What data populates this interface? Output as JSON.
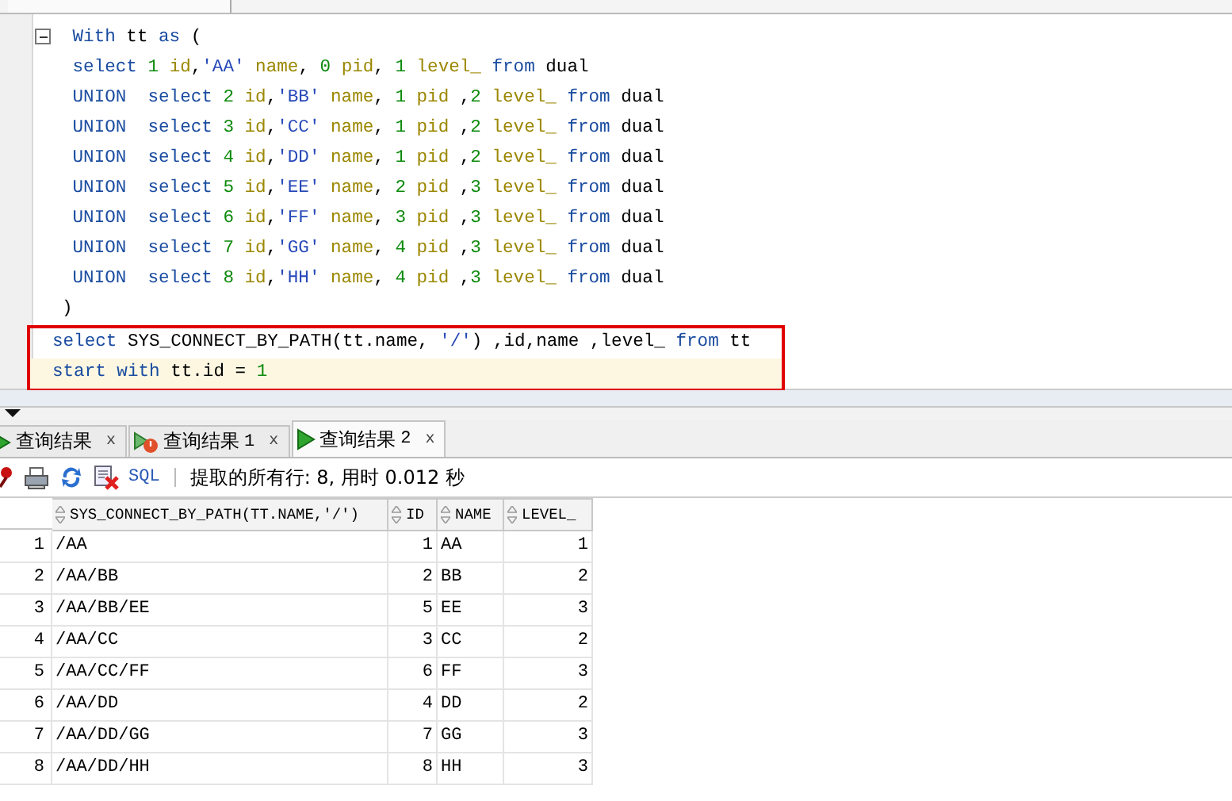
{
  "editor": {
    "lines": [
      {
        "boxed": false,
        "current": false,
        "tokens": [
          {
            "t": " With",
            "kind": "kw"
          },
          {
            "t": " tt ",
            "kind": "plain"
          },
          {
            "t": "as",
            "kind": "kw"
          },
          {
            "t": " (",
            "kind": "plain"
          }
        ]
      },
      {
        "boxed": false,
        "current": false,
        "tokens": [
          {
            "t": " select",
            "kind": "kw"
          },
          {
            "t": " 1 ",
            "kind": "num"
          },
          {
            "t": "id",
            "kind": "col"
          },
          {
            "t": ",",
            "kind": "plain"
          },
          {
            "t": "'AA'",
            "kind": "str"
          },
          {
            "t": " name",
            "kind": "col"
          },
          {
            "t": ", ",
            "kind": "plain"
          },
          {
            "t": "0 ",
            "kind": "num"
          },
          {
            "t": "pid",
            "kind": "col"
          },
          {
            "t": ", ",
            "kind": "plain"
          },
          {
            "t": "1 ",
            "kind": "num"
          },
          {
            "t": "level_ ",
            "kind": "col"
          },
          {
            "t": "from",
            "kind": "kw"
          },
          {
            "t": " dual",
            "kind": "plain"
          }
        ]
      },
      {
        "boxed": false,
        "current": false,
        "tokens": [
          {
            "t": " UNION  select",
            "kind": "kw"
          },
          {
            "t": " 2 ",
            "kind": "num"
          },
          {
            "t": "id",
            "kind": "col"
          },
          {
            "t": ",",
            "kind": "plain"
          },
          {
            "t": "'BB'",
            "kind": "str"
          },
          {
            "t": " name",
            "kind": "col"
          },
          {
            "t": ", ",
            "kind": "plain"
          },
          {
            "t": "1 ",
            "kind": "num"
          },
          {
            "t": "pid ",
            "kind": "col"
          },
          {
            "t": ",",
            "kind": "plain"
          },
          {
            "t": "2 ",
            "kind": "num"
          },
          {
            "t": "level_ ",
            "kind": "col"
          },
          {
            "t": "from",
            "kind": "kw"
          },
          {
            "t": " dual",
            "kind": "plain"
          }
        ]
      },
      {
        "boxed": false,
        "current": false,
        "tokens": [
          {
            "t": " UNION  select",
            "kind": "kw"
          },
          {
            "t": " 3 ",
            "kind": "num"
          },
          {
            "t": "id",
            "kind": "col"
          },
          {
            "t": ",",
            "kind": "plain"
          },
          {
            "t": "'CC'",
            "kind": "str"
          },
          {
            "t": " name",
            "kind": "col"
          },
          {
            "t": ", ",
            "kind": "plain"
          },
          {
            "t": "1 ",
            "kind": "num"
          },
          {
            "t": "pid ",
            "kind": "col"
          },
          {
            "t": ",",
            "kind": "plain"
          },
          {
            "t": "2 ",
            "kind": "num"
          },
          {
            "t": "level_ ",
            "kind": "col"
          },
          {
            "t": "from",
            "kind": "kw"
          },
          {
            "t": " dual",
            "kind": "plain"
          }
        ]
      },
      {
        "boxed": false,
        "current": false,
        "tokens": [
          {
            "t": " UNION  select",
            "kind": "kw"
          },
          {
            "t": " 4 ",
            "kind": "num"
          },
          {
            "t": "id",
            "kind": "col"
          },
          {
            "t": ",",
            "kind": "plain"
          },
          {
            "t": "'DD'",
            "kind": "str"
          },
          {
            "t": " name",
            "kind": "col"
          },
          {
            "t": ", ",
            "kind": "plain"
          },
          {
            "t": "1 ",
            "kind": "num"
          },
          {
            "t": "pid ",
            "kind": "col"
          },
          {
            "t": ",",
            "kind": "plain"
          },
          {
            "t": "2 ",
            "kind": "num"
          },
          {
            "t": "level_ ",
            "kind": "col"
          },
          {
            "t": "from",
            "kind": "kw"
          },
          {
            "t": " dual",
            "kind": "plain"
          }
        ]
      },
      {
        "boxed": false,
        "current": false,
        "tokens": [
          {
            "t": " UNION  select",
            "kind": "kw"
          },
          {
            "t": " 5 ",
            "kind": "num"
          },
          {
            "t": "id",
            "kind": "col"
          },
          {
            "t": ",",
            "kind": "plain"
          },
          {
            "t": "'EE'",
            "kind": "str"
          },
          {
            "t": " name",
            "kind": "col"
          },
          {
            "t": ", ",
            "kind": "plain"
          },
          {
            "t": "2 ",
            "kind": "num"
          },
          {
            "t": "pid ",
            "kind": "col"
          },
          {
            "t": ",",
            "kind": "plain"
          },
          {
            "t": "3 ",
            "kind": "num"
          },
          {
            "t": "level_ ",
            "kind": "col"
          },
          {
            "t": "from",
            "kind": "kw"
          },
          {
            "t": " dual",
            "kind": "plain"
          }
        ]
      },
      {
        "boxed": false,
        "current": false,
        "tokens": [
          {
            "t": " UNION  select",
            "kind": "kw"
          },
          {
            "t": " 6 ",
            "kind": "num"
          },
          {
            "t": "id",
            "kind": "col"
          },
          {
            "t": ",",
            "kind": "plain"
          },
          {
            "t": "'FF'",
            "kind": "str"
          },
          {
            "t": " name",
            "kind": "col"
          },
          {
            "t": ", ",
            "kind": "plain"
          },
          {
            "t": "3 ",
            "kind": "num"
          },
          {
            "t": "pid ",
            "kind": "col"
          },
          {
            "t": ",",
            "kind": "plain"
          },
          {
            "t": "3 ",
            "kind": "num"
          },
          {
            "t": "level_ ",
            "kind": "col"
          },
          {
            "t": "from",
            "kind": "kw"
          },
          {
            "t": " dual",
            "kind": "plain"
          }
        ]
      },
      {
        "boxed": false,
        "current": false,
        "tokens": [
          {
            "t": " UNION  select",
            "kind": "kw"
          },
          {
            "t": " 7 ",
            "kind": "num"
          },
          {
            "t": "id",
            "kind": "col"
          },
          {
            "t": ",",
            "kind": "plain"
          },
          {
            "t": "'GG'",
            "kind": "str"
          },
          {
            "t": " name",
            "kind": "col"
          },
          {
            "t": ", ",
            "kind": "plain"
          },
          {
            "t": "4 ",
            "kind": "num"
          },
          {
            "t": "pid ",
            "kind": "col"
          },
          {
            "t": ",",
            "kind": "plain"
          },
          {
            "t": "3 ",
            "kind": "num"
          },
          {
            "t": "level_ ",
            "kind": "col"
          },
          {
            "t": "from",
            "kind": "kw"
          },
          {
            "t": " dual",
            "kind": "plain"
          }
        ]
      },
      {
        "boxed": false,
        "current": false,
        "tokens": [
          {
            "t": " UNION  select",
            "kind": "kw"
          },
          {
            "t": " 8 ",
            "kind": "num"
          },
          {
            "t": "id",
            "kind": "col"
          },
          {
            "t": ",",
            "kind": "plain"
          },
          {
            "t": "'HH'",
            "kind": "str"
          },
          {
            "t": " name",
            "kind": "col"
          },
          {
            "t": ", ",
            "kind": "plain"
          },
          {
            "t": "4 ",
            "kind": "num"
          },
          {
            "t": "pid ",
            "kind": "col"
          },
          {
            "t": ",",
            "kind": "plain"
          },
          {
            "t": "3 ",
            "kind": "num"
          },
          {
            "t": "level_ ",
            "kind": "col"
          },
          {
            "t": "from",
            "kind": "kw"
          },
          {
            "t": " dual",
            "kind": "plain"
          }
        ]
      },
      {
        "boxed": false,
        "current": false,
        "tokens": [
          {
            "t": ")",
            "kind": "plain"
          }
        ]
      }
    ],
    "highlighted_lines": [
      {
        "boxed": true,
        "current": false,
        "tokens": [
          {
            "t": "select",
            "kind": "kw"
          },
          {
            "t": " SYS_CONNECT_BY_PATH(tt.name, ",
            "kind": "plain"
          },
          {
            "t": "'/'",
            "kind": "str"
          },
          {
            "t": ") ,id,name ,level_ ",
            "kind": "plain"
          },
          {
            "t": "from",
            "kind": "kw"
          },
          {
            "t": " tt",
            "kind": "plain"
          }
        ]
      },
      {
        "boxed": true,
        "current": true,
        "tokens": [
          {
            "t": "start with",
            "kind": "kw"
          },
          {
            "t": " tt.id = ",
            "kind": "plain"
          },
          {
            "t": "1",
            "kind": "num"
          }
        ]
      }
    ]
  },
  "result_tabs": [
    {
      "label": "查询结果",
      "kind": "ok",
      "close": "x",
      "selected": false
    },
    {
      "label": "查询结果",
      "number": "1",
      "kind": "error",
      "close": "x",
      "selected": false
    },
    {
      "label": "查询结果",
      "number": "2",
      "kind": "ok",
      "close": "x",
      "selected": true
    }
  ],
  "toolbar": {
    "sql_link": "SQL",
    "status": "提取的所有行: 8, 用时 0.012 秒"
  },
  "table": {
    "columns": [
      "SYS_CONNECT_BY_PATH(TT.NAME,'/')",
      "ID",
      "NAME",
      "LEVEL_"
    ],
    "rows": [
      {
        "num": "1",
        "cells": [
          "/AA",
          "1",
          "AA",
          "1"
        ]
      },
      {
        "num": "2",
        "cells": [
          "/AA/BB",
          "2",
          "BB",
          "2"
        ]
      },
      {
        "num": "3",
        "cells": [
          "/AA/BB/EE",
          "5",
          "EE",
          "3"
        ]
      },
      {
        "num": "4",
        "cells": [
          "/AA/CC",
          "3",
          "CC",
          "2"
        ]
      },
      {
        "num": "5",
        "cells": [
          "/AA/CC/FF",
          "6",
          "FF",
          "3"
        ]
      },
      {
        "num": "6",
        "cells": [
          "/AA/DD",
          "4",
          "DD",
          "2"
        ]
      },
      {
        "num": "7",
        "cells": [
          "/AA/DD/GG",
          "7",
          "GG",
          "3"
        ]
      },
      {
        "num": "8",
        "cells": [
          "/AA/DD/HH",
          "8",
          "HH",
          "3"
        ]
      }
    ]
  }
}
